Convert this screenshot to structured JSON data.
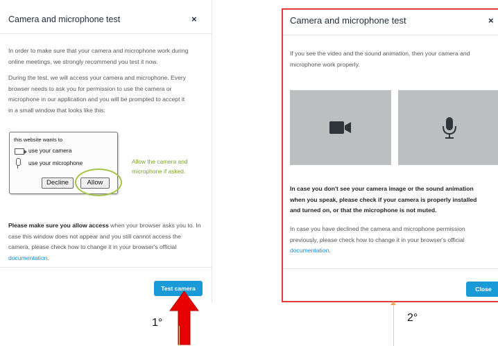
{
  "dialog1": {
    "title": "Camera and microphone test",
    "close_symbol": "×",
    "para1_lines": [
      "In order to make sure that your camera and microphone work during",
      "online meetings, we strongly recommend you test it now."
    ],
    "para2_lines": [
      "During the test, we will access your camera and microphone. Every",
      "browser needs to ask you for permission to use the camera or",
      "microphone in our application and you will be prompted to accept it",
      "in a small window that looks like this:"
    ],
    "popup": {
      "header": "this website wants to",
      "camera_label": "use your camera",
      "microphone_label": "use your microphone",
      "decline_label": "Decline",
      "allow_label": "Allow"
    },
    "allow_hint": "Allow the camera and microphone if asked.",
    "para3_bold": "Please make sure you allow access",
    "para3_rest_line1": " when your browser asks you to. In",
    "para3_lines": [
      "case this window does not appear and you still cannot access the",
      "camera, please check how to change it in your browser's official"
    ],
    "para3_link": "documentation",
    "para3_end": ".",
    "button_label": "Test camera",
    "step_label": "1°"
  },
  "dialog2": {
    "title": "Camera and microphone test",
    "close_symbol": "×",
    "intro_lines": [
      "If you see the video and the sound animation, then your camera and",
      "microphone work properly."
    ],
    "bold_lines": [
      "In case you don't see your camera image or the sound animation",
      "when you speak, please check if your camera is properly installed",
      "and turned on, or that the microphone is not muted."
    ],
    "declined_lines": [
      "In case you have declined the camera and microphone permission",
      "previously, please check how to change it in your browser's official"
    ],
    "declined_link": "documentation",
    "declined_end": ".",
    "button_label": "Close",
    "step_label": "2°"
  },
  "colors": {
    "primary": "#1a9bd8",
    "link": "#1a8bd3",
    "highlight_border": "#e23b3b",
    "allow_green": "#7aa22a",
    "arrow_red": "#e60000",
    "tile_gray": "#bcbfc0"
  }
}
